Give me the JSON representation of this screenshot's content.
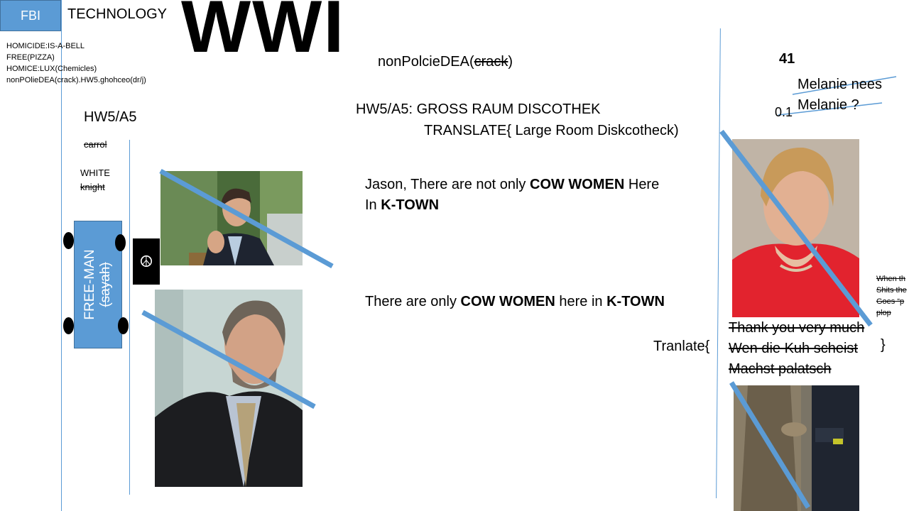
{
  "header": {
    "fbi_label": "FBI",
    "technology": "TECHNOLOGY",
    "wwi": "WWI"
  },
  "notes": [
    "HOMICIDE:IS-A-BELL",
    "FREE(PIZZA)",
    "HOMICE:LUX(Chemicles)",
    " nonPOlieDEA(crack).HW5.ghohceo(dr/j)"
  ],
  "left": {
    "hw5": "HW5/A5",
    "carrol": "carrol",
    "white": "WHITE",
    "knight": "knight",
    "car_label": "FREE-MAN",
    "car_sub": "(sayah)",
    "peace_symbol": "☮"
  },
  "center": {
    "nonpol_prefix": "nonPolcieDEA(",
    "nonpol_struck": "crack",
    "nonpol_suffix": ")",
    "hw5_line1": "HW5/A5:  GROSS RAUM DISCOTHEK",
    "hw5_line2": "TRANSLATE{ Large Room Diskcotheck)",
    "jason_a": "Jason, There are not only ",
    "jason_b": "COW WOMEN",
    "jason_c": " Here",
    "jason_d": "In ",
    "jason_e": "K-TOWN",
    "only_a": "There are only ",
    "only_b": "COW WOMEN",
    "only_c": " here in  ",
    "only_d": "K-TOWN"
  },
  "right": {
    "n41": "41",
    "melanie1": "Melanie nees",
    "melanie2": "Melanie ?",
    "n01": "0.1",
    "side_lines": [
      "When th",
      "Shits the",
      "Goes “p",
      "plop"
    ],
    "tranlate": "Tranlate{",
    "trans_lines": [
      "Thank you very much",
      "Wen die Kuh scheist",
      "Machst palatsch"
    ],
    "brace_close": "}"
  },
  "colors": {
    "accent": "#5b9bd5",
    "accent_border": "#41719c"
  }
}
